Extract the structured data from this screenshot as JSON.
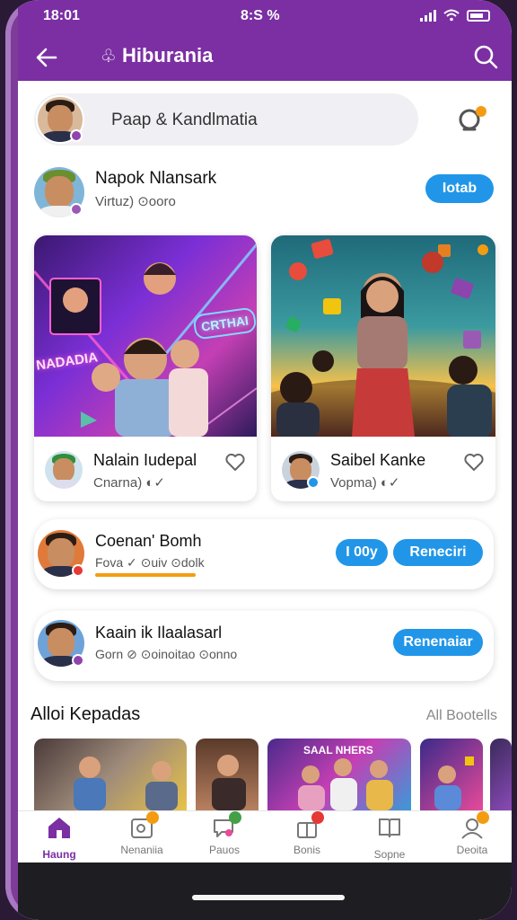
{
  "status": {
    "time": "18:01",
    "center": "8:S %"
  },
  "header": {
    "title": "Hiburania",
    "logo_glyph": "♧"
  },
  "search": {
    "placeholder": "Paap & Kandlmatia"
  },
  "featured_person": {
    "name": "Napok Nlansark",
    "sub": "Virtuz) ⊙ooro",
    "action": "Iotab"
  },
  "cards": [
    {
      "name": "Nalain Iudepal",
      "sub": "Cnarna) ◐✓",
      "poster_text_1": "NADADIA",
      "poster_text_2": "CRTHAI"
    },
    {
      "name": "Saibel Kanke",
      "sub": "Vopma) ◐✓"
    }
  ],
  "wide_rows": [
    {
      "name": "Coenan' Bomh",
      "sub": "Fova ✓ ⊙uiv ⊙dolk",
      "actions": [
        "I 00y",
        "Reneciri"
      ]
    },
    {
      "name": "Kaain ik Ilaalasarl",
      "sub": "Gorn ⊘ ⊙oinoitao ⊙onno",
      "actions": [
        "Renenaiar"
      ]
    }
  ],
  "section": {
    "title": "Alloi Kepadas",
    "link": "All Bootells"
  },
  "strip": {
    "banner_text": "SAAL NHERS"
  },
  "tabs": [
    {
      "label": "Haung"
    },
    {
      "label": "Nenaniia"
    },
    {
      "label": "Pauos"
    },
    {
      "label": "Bonis"
    },
    {
      "label": "Sopne"
    },
    {
      "label": "Deoita"
    }
  ],
  "colors": {
    "brand": "#7b2fa3",
    "accent": "#2196e8",
    "badge_orange": "#f39c12",
    "badge_red": "#e53935",
    "badge_green": "#43a047",
    "badge_purple": "#8e44ad"
  }
}
